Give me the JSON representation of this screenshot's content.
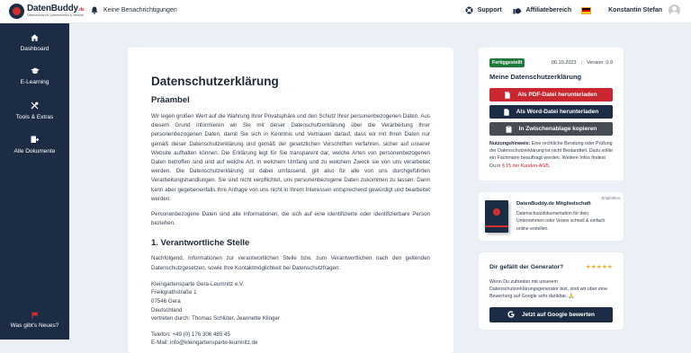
{
  "brand": {
    "name_main": "DatenBuddy",
    "name_suffix": ".de",
    "tagline": "Datenschutz für Unternehmen & Vereine"
  },
  "topbar": {
    "notifications": "Keine Benachrichtigungen",
    "support": "Support",
    "affiliate": "Affiliatebereich",
    "user_name": "Konstantin Stefan",
    "language_flag": "de"
  },
  "sidebar": {
    "items": [
      {
        "label": "Dashboard",
        "icon": "dashboard-icon"
      },
      {
        "label": "E-Learning",
        "icon": "graduation-cap-icon"
      },
      {
        "label": "Tools & Extras",
        "icon": "tools-icon"
      },
      {
        "label": "Alle Dokumente",
        "icon": "documents-icon"
      }
    ],
    "news": "Was gibt's Neues?"
  },
  "document": {
    "title": "Datenschutzerklärung",
    "preamble_heading": "Präambel",
    "preamble_p1": "Wir legen großen Wert auf die Wahrung Ihrer Privatsphäre und den Schutz Ihrer personenbezogenen Daten. Aus diesem Grund informieren wir Sie mit dieser Datenschutzerklärung über die Verarbeitung Ihrer personenbezogenen Daten, damit Sie sich in Kenntnis und Vertrauen darauf, dass wir mit Ihren Daten nur gemäß dieser Datenschutzerklärung und gemäß der gesetzlichen Vorschriften verfahren, sicher auf unserer Website aufhalten können. Die Erklärung legt für Sie transparent dar, welche Arten von personenbezogenen Daten betroffen sind und auf welche Art, in welchem Umfang und zu welchem Zweck sie von uns verarbeitet werden. Die Datenschutzerklärung ist dabei umfassend, gilt also für alle von uns durchgeführten Verarbeitungshandlungen. Sie sind nicht verpflichtet, uns personenbezogene Daten zukommen zu lassen. Dann kann aber gegebenenfalls Ihre Anfrage von uns nicht in Ihrem Interessen entsprechend gewürdigt und bearbeitet werden.",
    "preamble_p2": "Personenbezogene Daten sind alle Informationen, die sich auf eine identifizierte oder identifizierbare Person beziehen.",
    "section1_heading": "1. Verantwortliche Stelle",
    "section1_intro": "Nachfolgend, Informationen zur verantwortlichen Stelle bzw. zum Verantwortlichen nach den geltenden Datenschutzgesetzen, sowie Ihre Kontaktmöglichkeit bei Datenschutzfragen:",
    "address": [
      "Kleingartensparte Gera-Leumnitz e.V.",
      "Freikgrathstraße 1",
      "07546 Gera",
      "Deutschland",
      "vertreten durch: Thomas Schlüter, Jeannette Klinger"
    ],
    "phone": "Telefon:  +49 (0) 176 306 485 45",
    "email": "E-Mail:  info@kleingartensparte-leumnitz.de"
  },
  "status_card": {
    "badge": "Fertiggestellt",
    "date": "06.10.2023",
    "version": "Version: 0.9",
    "title": "Meine Datenschutzerklärung",
    "btn_pdf": "Als PDF-Datei herunterladen",
    "btn_word": "Als Word-Datei herunterladen",
    "btn_copy": "In Zwischenablage kopieren",
    "hint_label": "Nutzungshinweis:",
    "hint_text": " Eine rechtliche Beratung oder Prüfung der Datenschutzerklärung ist nicht Bestandteil. Dazu sollte ein Fachmann beauftragt werden. Weitere Infos findest Du in ",
    "hint_link": "§ 15 der Kunden-AGB",
    "hint_end": ".",
    "colors": {
      "badge": "#1f7a3a",
      "pdf": "#c9262f",
      "word": "#1b2c44",
      "copy": "#474c54"
    }
  },
  "promo_card": {
    "tag": "Empfohlen",
    "title": "DatenBuddy.de Mitgliedschaft",
    "text": "Datenschutzdokumentation für dein Unternehmen oder Verein schnell & einfach online erstellen."
  },
  "rating_card": {
    "title": "Dir gefällt der Generator?",
    "stars": "★★★★★",
    "text": "Wenn Du zufrieden mit unserem Datenschutzerklärungsgenerator bist, sind wir über eine Bewertung auf Google sehr dankbar. 🙏",
    "button": "Jetzt auf Google bewerten"
  }
}
